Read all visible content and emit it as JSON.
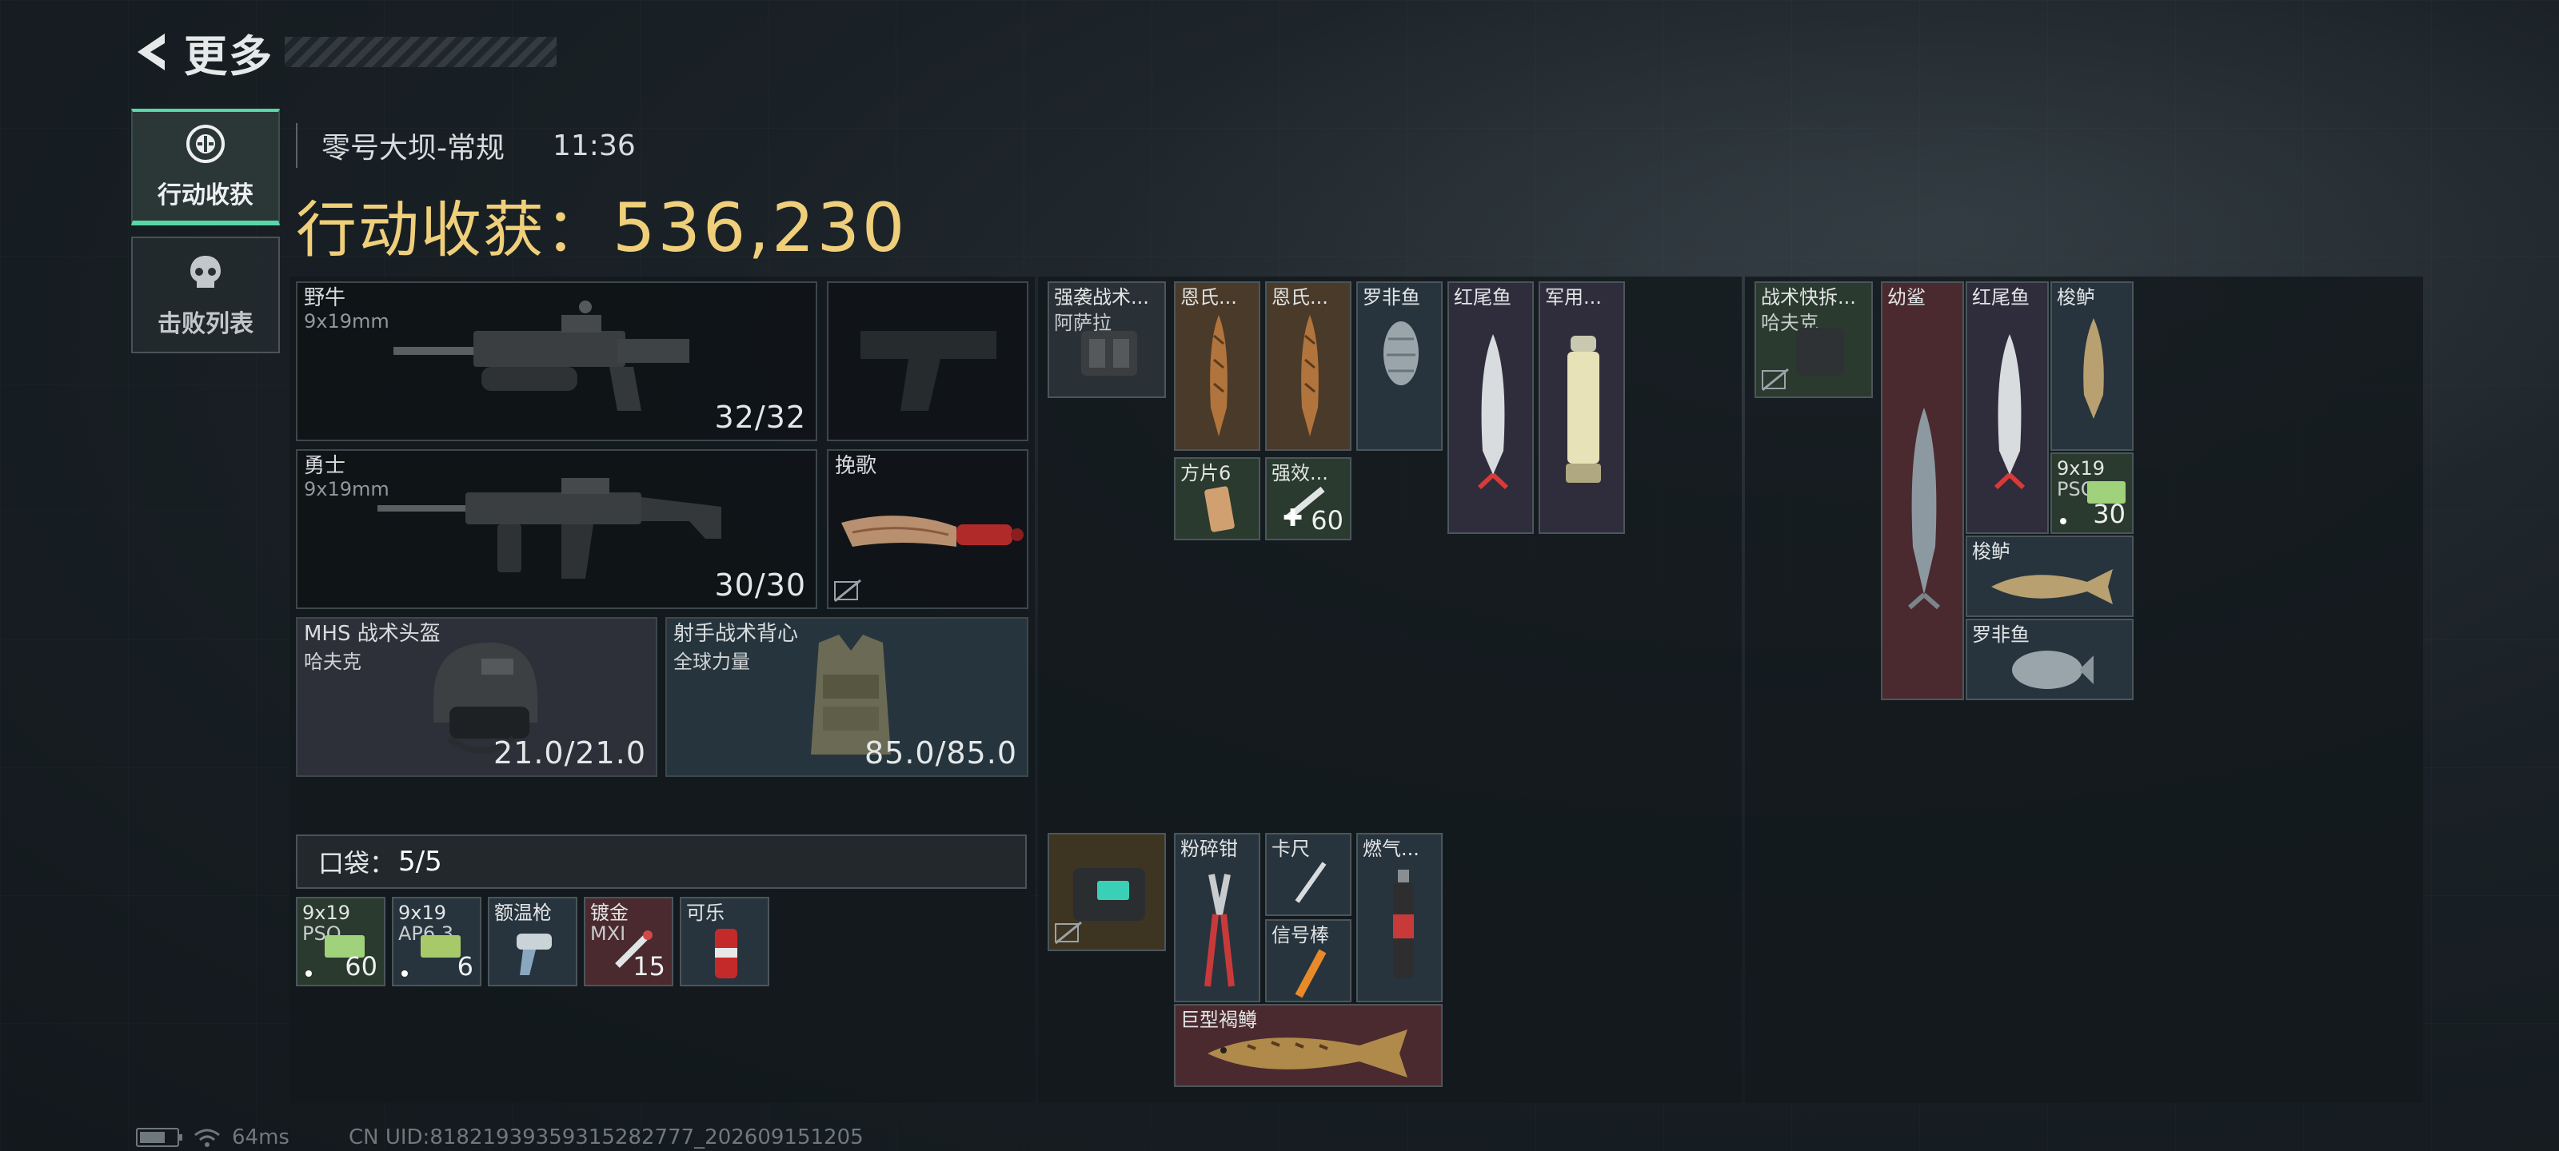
{
  "header": {
    "title": "更多",
    "map": "零号大坝-常规",
    "time": "11:36",
    "loot_label": "行动收获：",
    "loot_value": "536,230"
  },
  "sidenav": [
    {
      "label": "行动收获",
      "icon": "loot-icon",
      "active": true
    },
    {
      "label": "击败列表",
      "icon": "skull-icon",
      "active": false
    }
  ],
  "equipment": {
    "primary": {
      "name": "野牛",
      "ammo": "9x19mm",
      "value": "32/32"
    },
    "secondary": {
      "name": "勇士",
      "ammo": "9x19mm",
      "value": "30/30"
    },
    "pistol": {
      "name": ""
    },
    "melee": {
      "name": "挽歌"
    },
    "helmet": {
      "name": "MHS 战术头盔",
      "brand": "哈夫克",
      "value": "21.0/21.0"
    },
    "armor": {
      "name": "射手战术背心",
      "brand": "全球力量",
      "value": "85.0/85.0"
    }
  },
  "pocket": {
    "label": "口袋：",
    "count": "5/5",
    "items": [
      {
        "name": "9x19",
        "name2": "PSO",
        "qty": "60"
      },
      {
        "name": "9x19",
        "name2": "AP6.3",
        "qty": "6"
      },
      {
        "name": "额温枪",
        "name2": "",
        "qty": ""
      },
      {
        "name": "镀金",
        "name2": "MXI",
        "qty": "15"
      },
      {
        "name": "可乐",
        "name2": "",
        "qty": ""
      }
    ]
  },
  "bag": {
    "rig": {
      "name": "强袭战术...",
      "name2": "阿萨拉"
    },
    "items": [
      {
        "name": "恩氏..."
      },
      {
        "name": "恩氏..."
      },
      {
        "name": "罗非鱼"
      },
      {
        "name": "红尾鱼"
      },
      {
        "name": "军用..."
      },
      {
        "name": "方片6"
      },
      {
        "name": "强效...",
        "qty": "60"
      }
    ],
    "case_items": [
      {
        "name": "粉碎钳"
      },
      {
        "name": "卡尺"
      },
      {
        "name": "燃气..."
      },
      {
        "name": "信号棒"
      },
      {
        "name": "巨型褐鳟"
      }
    ]
  },
  "extra": {
    "rig": {
      "name": "战术快拆...",
      "name2": "哈夫克"
    },
    "items": [
      {
        "name": "幼鲨"
      },
      {
        "name": "红尾鱼"
      },
      {
        "name": "梭鲈"
      },
      {
        "name": "9x19",
        "name2": "PSO",
        "qty": "30"
      },
      {
        "name": "梭鲈"
      },
      {
        "name": "罗非鱼"
      }
    ]
  },
  "footer": {
    "battery_level_pct": 70,
    "ping": "64ms",
    "uid": "CN UID:81821939359315282777_202609151205"
  }
}
